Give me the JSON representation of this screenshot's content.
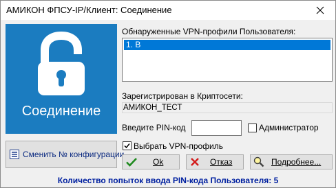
{
  "window": {
    "title": "АМИКОН ФПСУ-IP/Клиент: Соединение"
  },
  "logo": {
    "caption": "Соединение",
    "background_color": "#1b7cc0",
    "icon": "unlocked-padlock-icon"
  },
  "buttons": {
    "change_config": "Сменить № конфигурации",
    "ok": "Ok",
    "cancel": "Отказ",
    "details": "Подробнее..."
  },
  "vpn_profiles": {
    "label": "Обнаруженные VPN-профили Пользователя:",
    "items": [
      "1. B"
    ],
    "selected_index": 0
  },
  "registration": {
    "label": "Зарегистрирован в Криптосети:",
    "value": "АМИКОН_ТЕСТ"
  },
  "pin": {
    "label": "Введите PIN-код",
    "value": ""
  },
  "admin_checkbox": {
    "label": "Администратор",
    "checked": false
  },
  "choose_profile_checkbox": {
    "label": "Выбрать VPN-профиль",
    "checked": true
  },
  "status": {
    "text": "Количество попыток ввода PIN-кода Пользователя: 5"
  }
}
